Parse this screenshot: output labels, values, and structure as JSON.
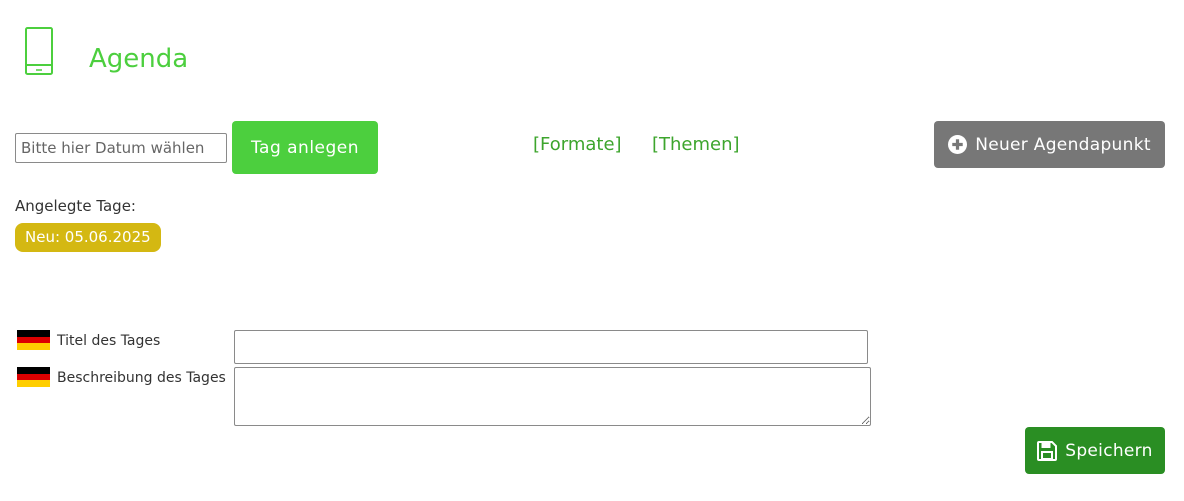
{
  "header": {
    "icon": "mobile-phone-icon",
    "title": "Agenda",
    "accent_color": "#4ccf3e"
  },
  "toolbar": {
    "date_placeholder": "Bitte hier Datum wählen",
    "add_day_label": "Tag anlegen",
    "formats_link": "[Formate]",
    "topics_link": "[Themen]",
    "new_agenda_label": "Neuer Agendapunkt",
    "new_agenda_icon": "plus-circle-icon"
  },
  "days": {
    "label": "Angelegte Tage:",
    "items": [
      {
        "label": "Neu: 05.06.2025",
        "color": "#d4b812"
      }
    ]
  },
  "form": {
    "language_flag": "germany-flag-icon",
    "title_label": "Titel des Tages",
    "title_value": "",
    "description_label": "Beschreibung des Tages",
    "description_value": ""
  },
  "actions": {
    "save_label": "Speichern",
    "save_icon": "floppy-disk-icon",
    "save_color": "#2a8e23"
  }
}
